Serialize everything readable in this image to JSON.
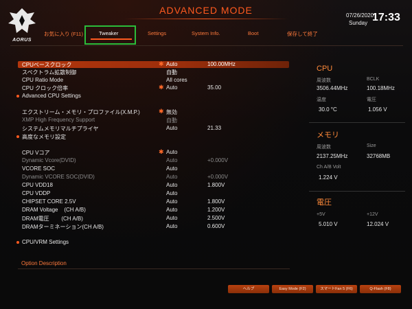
{
  "header": {
    "mode_title": "ADVANCED MODE",
    "logo_text": "AORUS",
    "date": "07/26/2020",
    "day": "Sunday",
    "time": "17:33"
  },
  "tabs": [
    {
      "label": "お気に入り (F11)"
    },
    {
      "label": "Tweaker",
      "active": true
    },
    {
      "label": "Settings"
    },
    {
      "label": "System Info."
    },
    {
      "label": "Boot"
    },
    {
      "label": "保存して終了"
    }
  ],
  "settings": [
    {
      "name": "CPUベースクロック",
      "val1": "Auto",
      "val2": "100.00MHz",
      "star": true,
      "selected": true
    },
    {
      "name": "スペクトラム拡散制御",
      "val1": "自動",
      "val2": ""
    },
    {
      "name": "CPU Ratio Mode",
      "val1": "All cores",
      "val2": ""
    },
    {
      "name": "CPU クロック倍率",
      "val1": "Auto",
      "val2": "35.00",
      "star": true
    },
    {
      "name": "Advanced CPU Settings",
      "bullet": true
    },
    {
      "name": "エクストリーム・メモリ・プロファイル(X.M.P.)",
      "val1": "無効",
      "star": true
    },
    {
      "name": "XMP High Frequency Support",
      "val1": "自動",
      "dim": true
    },
    {
      "name": "システムメモリマルチプライヤ",
      "val1": "Auto",
      "val2": "21.33"
    },
    {
      "name": "高度なメモリ設定",
      "bullet": true
    },
    {
      "name": "CPU Vコア",
      "val1": "Auto",
      "star": true
    },
    {
      "name": "Dynamic Vcore(DVID)",
      "val1": "Auto",
      "val2": "+0.000V",
      "dim": true
    },
    {
      "name": "VCORE SOC",
      "val1": "Auto"
    },
    {
      "name": "Dynamic VCORE SOC(DVID)",
      "val1": "Auto",
      "val2": "+0.000V",
      "dim": true
    },
    {
      "name": "CPU VDD18",
      "val1": "Auto",
      "val2": "1.800V"
    },
    {
      "name": "CPU VDDP",
      "val1": "Auto"
    },
    {
      "name": "CHIPSET CORE 2.5V",
      "val1": "Auto",
      "val2": "1.800V"
    },
    {
      "name": "DRAM Voltage    (CH A/B)",
      "val1": "Auto",
      "val2": "1.200V"
    },
    {
      "name": "DRAM電圧        (CH A/B)",
      "val1": "Auto",
      "val2": "2.500V"
    },
    {
      "name": "DRAMターミネーション(CH A/B)",
      "val1": "Auto",
      "val2": "0.600V"
    },
    {
      "name": "CPU/VRM Settings",
      "bullet": true
    }
  ],
  "option_description": "Option Description",
  "right_panel": {
    "cpu": {
      "title": "CPU",
      "freq_label": "周波数",
      "freq_value": "3506.44MHz",
      "bclk_label": "BCLK",
      "bclk_value": "100.18MHz",
      "temp_label": "温度",
      "temp_value": "30.0 °C",
      "volt_label": "電圧",
      "volt_value": "1.056 V"
    },
    "memory": {
      "title": "メモリ",
      "freq_label": "周波数",
      "freq_value": "2137.25MHz",
      "size_label": "Size",
      "size_value": "32768MB",
      "volt_label": "Ch A/B Volt",
      "volt_value": "1.224 V"
    },
    "voltage": {
      "title": "電圧",
      "v5_label": "+5V",
      "v5_value": "5.010 V",
      "v12_label": "+12V",
      "v12_value": "12.024 V"
    }
  },
  "footer_buttons": [
    {
      "label": "ヘルプ"
    },
    {
      "label": "Easy Mode (F2)"
    },
    {
      "label": "スマートFan 5 (F6)"
    },
    {
      "label": "Q-Flash (F8)"
    }
  ],
  "colors": {
    "accent": "#ff5a1f",
    "selection": "#b3360d",
    "highlight_box": "#2bbd3a"
  }
}
